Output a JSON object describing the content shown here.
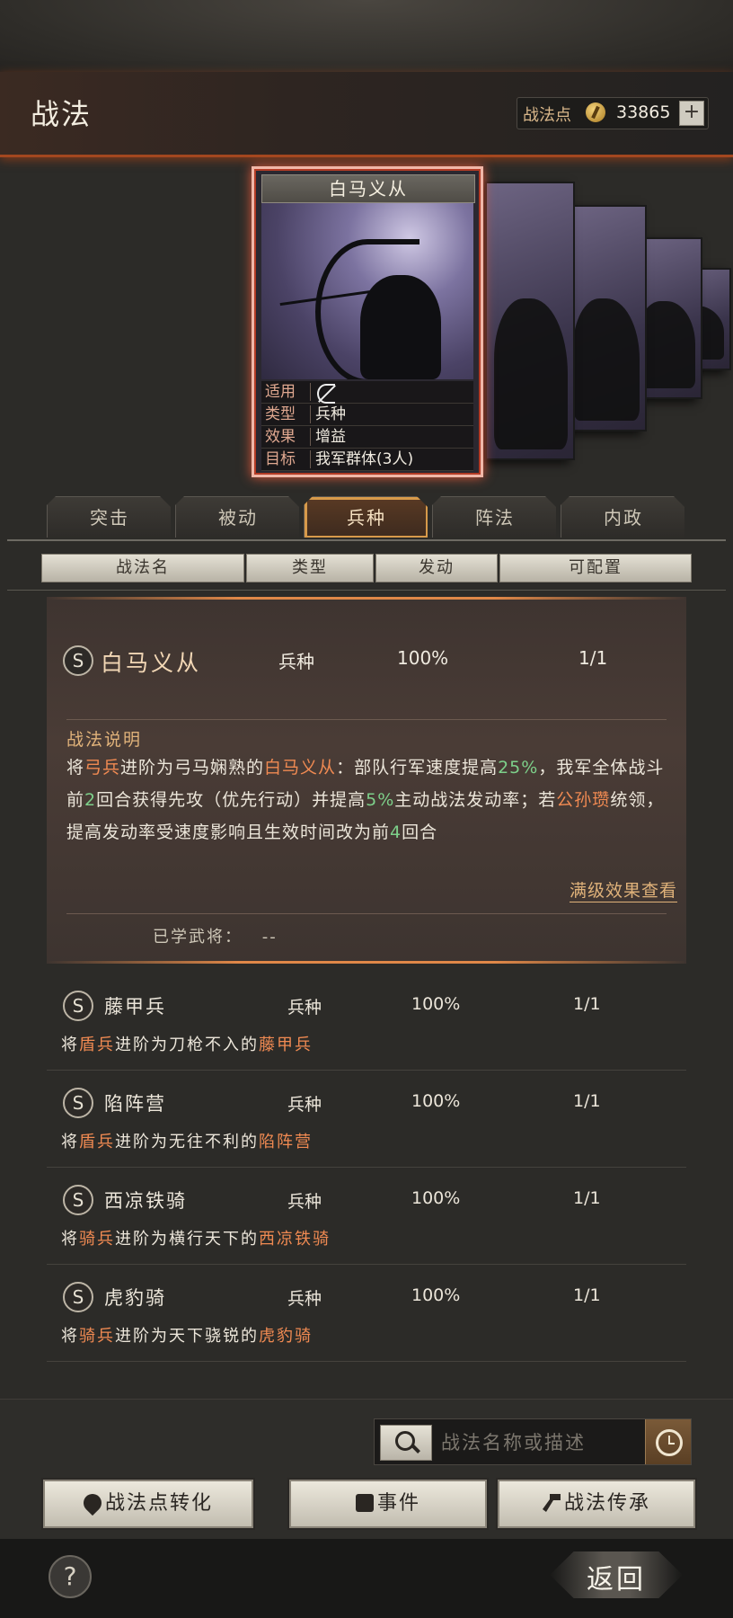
{
  "header": {
    "title": "战法",
    "points_label": "战法点",
    "points_value": "33865",
    "plus": "+"
  },
  "card": {
    "title": "白马义从",
    "rows": [
      {
        "key": "适用",
        "value": ""
      },
      {
        "key": "类型",
        "value": "兵种"
      },
      {
        "key": "效果",
        "value": "增益"
      },
      {
        "key": "目标",
        "value": "我军群体(3人)"
      }
    ]
  },
  "tabs": [
    {
      "label": "突击",
      "active": false
    },
    {
      "label": "被动",
      "active": false
    },
    {
      "label": "兵种",
      "active": true
    },
    {
      "label": "阵法",
      "active": false
    },
    {
      "label": "内政",
      "active": false
    }
  ],
  "table_headers": [
    "战法名",
    "类型",
    "发动",
    "可配置"
  ],
  "selected": {
    "grade": "S",
    "name": "白马义从",
    "type": "兵种",
    "rate": "100%",
    "config": "1/1",
    "desc_title": "战法说明",
    "desc_parts": [
      {
        "t": "将",
        "c": ""
      },
      {
        "t": "弓兵",
        "c": "o"
      },
      {
        "t": "进阶为弓马娴熟的",
        "c": ""
      },
      {
        "t": "白马义从",
        "c": "o"
      },
      {
        "t": "：部队行军速度提高",
        "c": ""
      },
      {
        "t": "25%",
        "c": "g"
      },
      {
        "t": "，我军全体战斗前",
        "c": ""
      },
      {
        "t": "2",
        "c": "g"
      },
      {
        "t": "回合获得先攻（优先行动）并提高",
        "c": ""
      },
      {
        "t": "5%",
        "c": "g"
      },
      {
        "t": "主动战法发动率；若",
        "c": ""
      },
      {
        "t": "公孙瓒",
        "c": "o"
      },
      {
        "t": "统领，提高发动率受速度影响且生效时间改为前",
        "c": ""
      },
      {
        "t": "4",
        "c": "g"
      },
      {
        "t": "回合",
        "c": ""
      }
    ],
    "full_link": "满级效果查看",
    "learned_label": "已学武将：",
    "learned_value": "--"
  },
  "rows": [
    {
      "grade": "S",
      "name": "藤甲兵",
      "type": "兵种",
      "rate": "100%",
      "config": "1/1",
      "sub": [
        {
          "t": "将",
          "c": ""
        },
        {
          "t": "盾兵",
          "c": "o"
        },
        {
          "t": "进阶为刀枪不入的",
          "c": ""
        },
        {
          "t": "藤甲兵",
          "c": "o"
        }
      ]
    },
    {
      "grade": "S",
      "name": "陷阵营",
      "type": "兵种",
      "rate": "100%",
      "config": "1/1",
      "sub": [
        {
          "t": "将",
          "c": ""
        },
        {
          "t": "盾兵",
          "c": "o"
        },
        {
          "t": "进阶为无往不利的",
          "c": ""
        },
        {
          "t": "陷阵营",
          "c": "o"
        }
      ]
    },
    {
      "grade": "S",
      "name": "西凉铁骑",
      "type": "兵种",
      "rate": "100%",
      "config": "1/1",
      "sub": [
        {
          "t": "将",
          "c": ""
        },
        {
          "t": "骑兵",
          "c": "o"
        },
        {
          "t": "进阶为横行天下的",
          "c": ""
        },
        {
          "t": "西凉铁骑",
          "c": "o"
        }
      ]
    },
    {
      "grade": "S",
      "name": "虎豹骑",
      "type": "兵种",
      "rate": "100%",
      "config": "1/1",
      "sub": [
        {
          "t": "将",
          "c": ""
        },
        {
          "t": "骑兵",
          "c": "o"
        },
        {
          "t": "进阶为天下骁锐的",
          "c": ""
        },
        {
          "t": "虎豹骑",
          "c": "o"
        }
      ]
    }
  ],
  "search": {
    "placeholder": "战法名称或描述"
  },
  "buttons": {
    "convert": "战法点转化",
    "events": "事件",
    "inherit": "战法传承"
  },
  "footer": {
    "help": "?",
    "back": "返回"
  },
  "colors": {
    "accent_orange": "#f08a52",
    "accent_green": "#7dd08a",
    "header_glow": "#a3471f"
  }
}
